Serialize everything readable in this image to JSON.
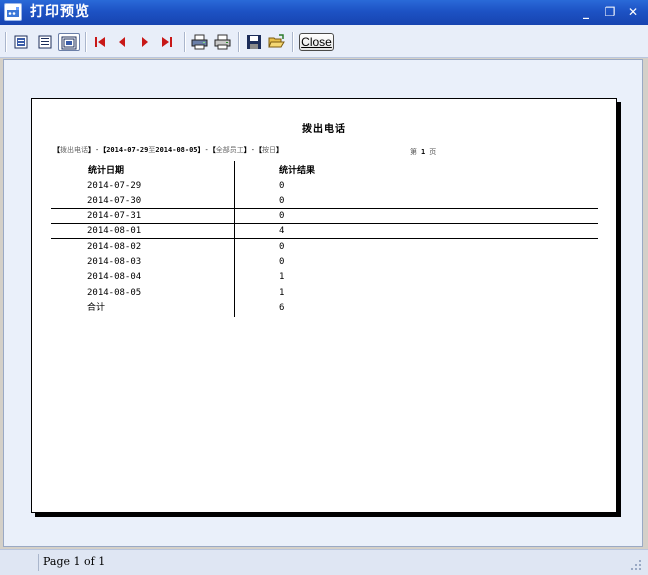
{
  "window": {
    "title": "打印预览",
    "minimize_glyph": "_",
    "restore_glyph": "❐",
    "close_glyph": "✕"
  },
  "toolbar": {
    "close_label": "Close",
    "icons": [
      "page-view-icon",
      "list-view-icon",
      "page-setup-icon",
      "first-page-icon",
      "previous-page-icon",
      "next-page-icon",
      "last-page-icon",
      "printer-setup-icon",
      "print-icon",
      "save-icon",
      "open-icon"
    ]
  },
  "report": {
    "title": "拨出电话",
    "criteria": {
      "type_open": "【",
      "type": "拨出电话",
      "type_close": "】",
      "sep1": "-",
      "date_open": "【",
      "date_from": "2014-07-29",
      "date_to_word": "至",
      "date_to": "2014-08-05",
      "date_close": "】",
      "sep2": "-",
      "staff_open": "【",
      "staff": "全部员工",
      "staff_close": "】",
      "sep3": "-",
      "unit_open": "【",
      "unit": "按日",
      "unit_close": "】"
    },
    "page_prefix": "第",
    "page_number": "1",
    "page_suffix": "页",
    "columns": [
      "统计日期",
      "统计结果"
    ],
    "rows": [
      {
        "date": "2014-07-29",
        "value": "0"
      },
      {
        "date": "2014-07-30",
        "value": "0"
      },
      {
        "date": "2014-07-31",
        "value": "0"
      },
      {
        "date": "2014-08-01",
        "value": "4"
      },
      {
        "date": "2014-08-02",
        "value": "0"
      },
      {
        "date": "2014-08-03",
        "value": "0"
      },
      {
        "date": "2014-08-04",
        "value": "1"
      },
      {
        "date": "2014-08-05",
        "value": "1"
      }
    ],
    "total_label": "合计",
    "total_value": "6"
  },
  "status": {
    "text": "Page 1 of 1"
  }
}
